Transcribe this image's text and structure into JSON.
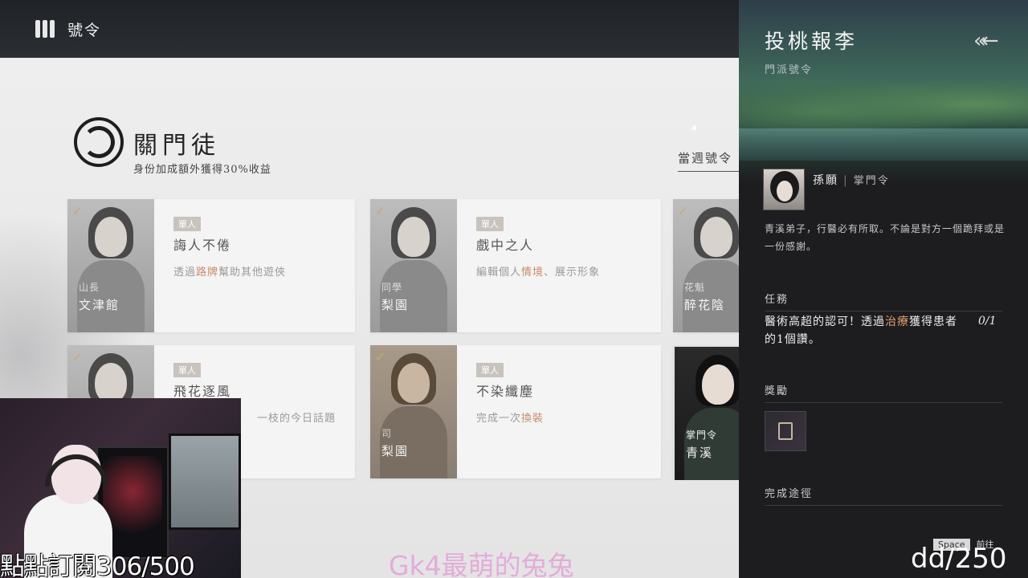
{
  "header": {
    "title": "號令"
  },
  "sect": {
    "title": "關門徒",
    "subtitle": "身份加成額外獲得30%收益",
    "weekly_tab": "當週號令"
  },
  "cards": [
    {
      "tag": "單人",
      "name": "誨人不倦",
      "desc_pre": "透過",
      "desc_hl": "路牌",
      "desc_post": "幫助其他遊俠",
      "loc_small": "山長",
      "loc": "文津館",
      "done": "✓"
    },
    {
      "tag": "單人",
      "name": "戲中之人",
      "desc_pre": "編輯個人",
      "desc_hl": "情境",
      "desc_post": "、展示形象",
      "loc_small": "同學",
      "loc": "梨園",
      "done": "✓"
    },
    {
      "tag": "",
      "name": "",
      "desc_pre": "",
      "desc_hl": "",
      "desc_post": "",
      "loc_small": "花魁",
      "loc": "醉花陰",
      "done": "✓"
    },
    {
      "tag": "單人",
      "name": "飛花逐風",
      "desc_pre": "",
      "desc_hl": "",
      "desc_post": "一枝的今日話題",
      "loc_small": "",
      "loc": "",
      "done": "✓"
    },
    {
      "tag": "單人",
      "name": "不染纖塵",
      "desc_pre": "完成一次",
      "desc_hl": "換裝",
      "desc_post": "",
      "loc_small": "司",
      "loc": "梨園",
      "done": "✓"
    },
    {
      "tag": "",
      "name": "",
      "desc_pre": "",
      "desc_hl": "",
      "desc_post": "",
      "loc_small": "掌門令",
      "loc": "青溪",
      "done": ""
    }
  ],
  "panel": {
    "title": "投桃報李",
    "subtitle": "門派號令",
    "back_icon": "«←",
    "npc_name": "孫願",
    "npc_role": "掌門令",
    "story": "青溪弟子，行醫必有所取。不論是對方一個跪拜或是一份感謝。",
    "task_label": "任務",
    "task_pre": "醫術高超的認可！透過",
    "task_hl": "治療",
    "task_post": "獲得患者的1個讚。",
    "task_progress": "0/1",
    "reward_label": "獎勵",
    "route_label": "完成途徑",
    "goto_key": "Space",
    "goto_label": "前往"
  },
  "overlay": {
    "left": "點點訂閱306/500",
    "mid": "Gk4最萌的兔兔",
    "right": "dd/250"
  },
  "colors": {
    "highlight": "#c98a6a",
    "panel_bg": "#1d1d1f"
  }
}
